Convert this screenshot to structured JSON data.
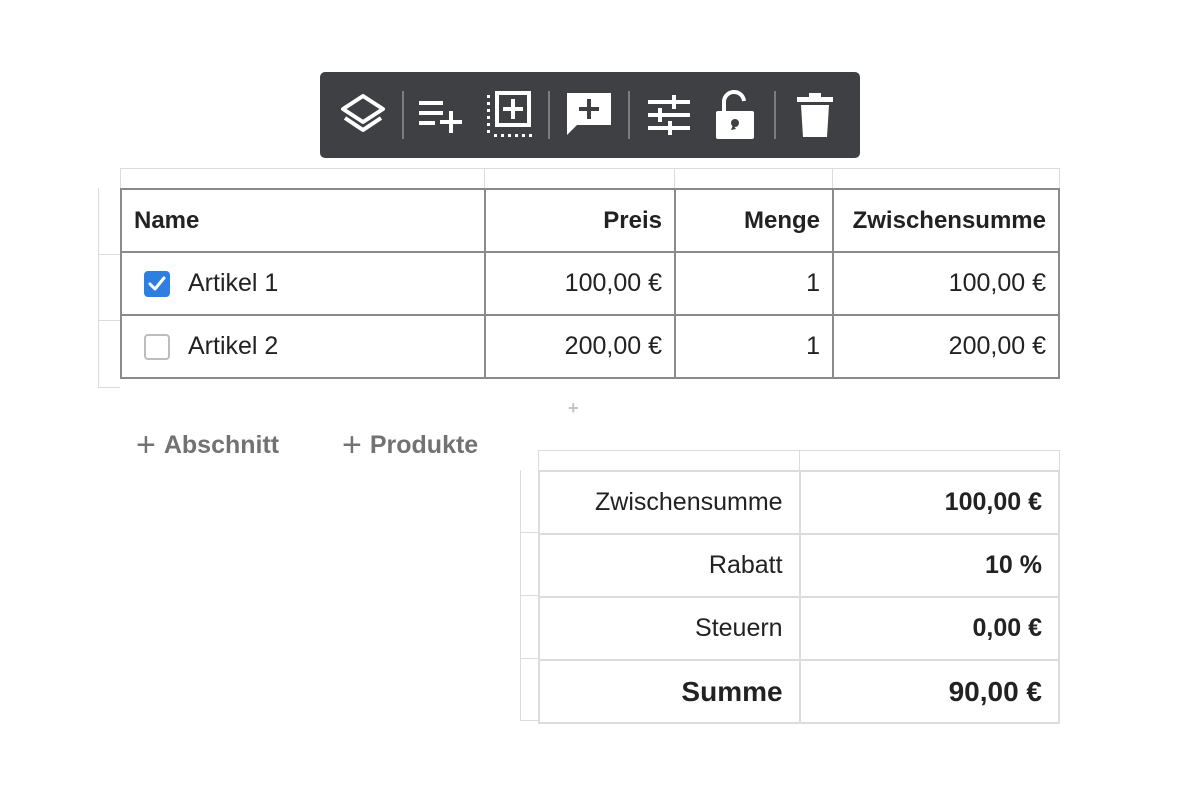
{
  "toolbar": {
    "buttons": [
      {
        "icon": "layers-icon"
      },
      {
        "icon": "add-row-icon"
      },
      {
        "icon": "add-block-icon"
      },
      {
        "icon": "add-comment-icon"
      },
      {
        "icon": "settings-sliders-icon"
      },
      {
        "icon": "unlock-icon"
      },
      {
        "icon": "trash-icon"
      }
    ]
  },
  "items_table": {
    "headers": {
      "name": "Name",
      "price": "Preis",
      "qty": "Menge",
      "subtotal": "Zwischensumme"
    },
    "rows": [
      {
        "checked": true,
        "name": "Artikel 1",
        "price": "100,00 €",
        "qty": "1",
        "subtotal": "100,00 €"
      },
      {
        "checked": false,
        "name": "Artikel 2",
        "price": "200,00 €",
        "qty": "1",
        "subtotal": "200,00 €"
      }
    ]
  },
  "add_actions": {
    "section": "Abschnitt",
    "products": "Produkte"
  },
  "totals": {
    "subtotal_label": "Zwischensumme",
    "subtotal_value": "100,00 €",
    "discount_label": "Rabatt",
    "discount_value": "10 %",
    "tax_label": "Steuern",
    "tax_value": "0,00 €",
    "total_label": "Summe",
    "total_value": "90,00 €"
  },
  "colors": {
    "toolbar_bg": "#3f4044",
    "checkbox_checked": "#2f7fe0",
    "link_gray": "#727272"
  }
}
